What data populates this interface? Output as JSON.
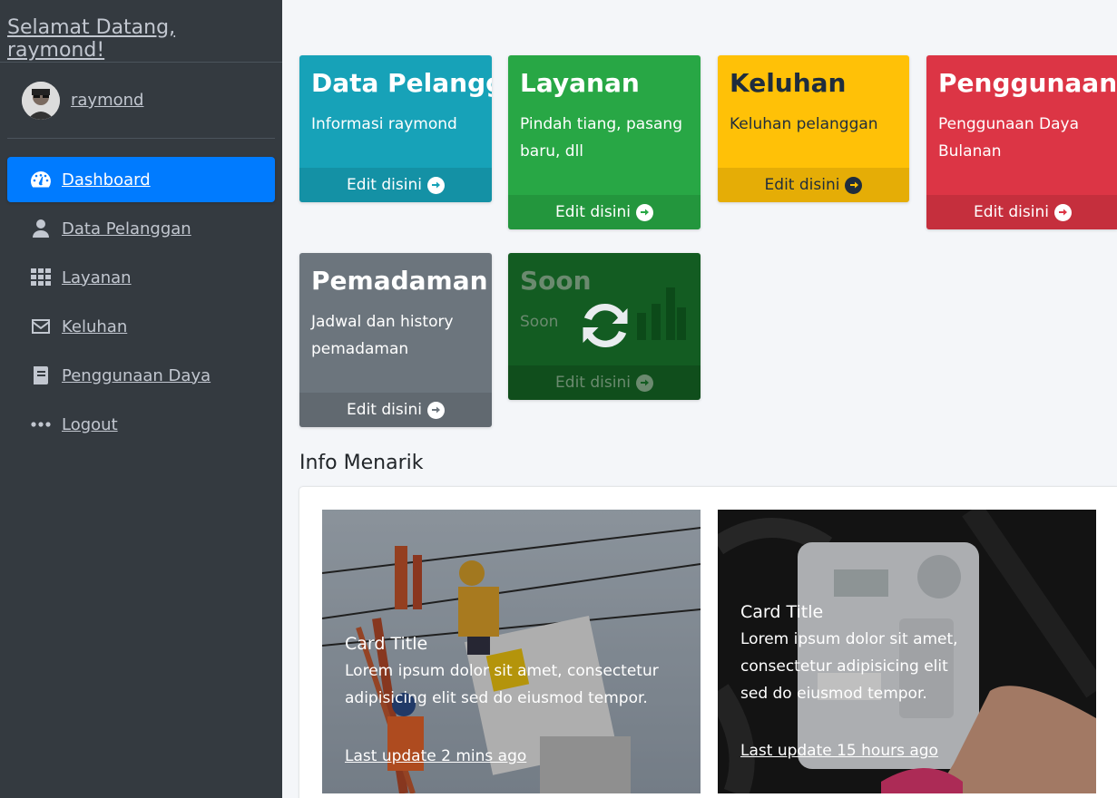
{
  "sidebar": {
    "brand": "Selamat Datang, raymond!",
    "user": {
      "name": "raymond"
    },
    "items": [
      {
        "label": "Dashboard",
        "icon": "tachometer-icon",
        "active": true
      },
      {
        "label": "Data Pelanggan",
        "icon": "user-icon"
      },
      {
        "label": "Layanan",
        "icon": "grid-icon"
      },
      {
        "label": "Keluhan",
        "icon": "envelope-icon"
      },
      {
        "label": "Penggunaan Daya",
        "icon": "book-icon"
      },
      {
        "label": "Logout",
        "icon": "ellipsis-icon"
      }
    ]
  },
  "boxes": [
    {
      "title": "Data Pelanggan",
      "text": "Informasi raymond",
      "footer": "Edit disini",
      "color": "#17a2b8"
    },
    {
      "title": "Layanan",
      "text": "Pindah tiang, pasang baru, dll",
      "footer": "Edit disini",
      "color": "#28a745"
    },
    {
      "title": "Keluhan",
      "text": "Keluhan pelanggan",
      "footer": "Edit disini",
      "color": "#ffc107"
    },
    {
      "title": "Penggunaan Daya",
      "text": "Penggunaan Daya Bulanan",
      "footer": "Edit disini",
      "color": "#dc3545"
    },
    {
      "title": "Pemadaman",
      "text": "Jadwal dan history pemadaman",
      "footer": "Edit disini",
      "color": "#6c757d"
    },
    {
      "title": "Soon",
      "text": "Soon",
      "footer": "Edit disini",
      "color": "#135c22"
    }
  ],
  "info": {
    "title": "Info Menarik",
    "cards": [
      {
        "title": "Card Title",
        "text": "Lorem ipsum dolor sit amet, consectetur adipisicing elit sed do eiusmod tempor.",
        "update": "Last update 2 mins ago"
      },
      {
        "title": "Card Title",
        "text": "Lorem ipsum dolor sit amet, consectetur adipisicing elit sed do eiusmod tempor.",
        "update": "Last update 15 hours ago"
      }
    ]
  }
}
